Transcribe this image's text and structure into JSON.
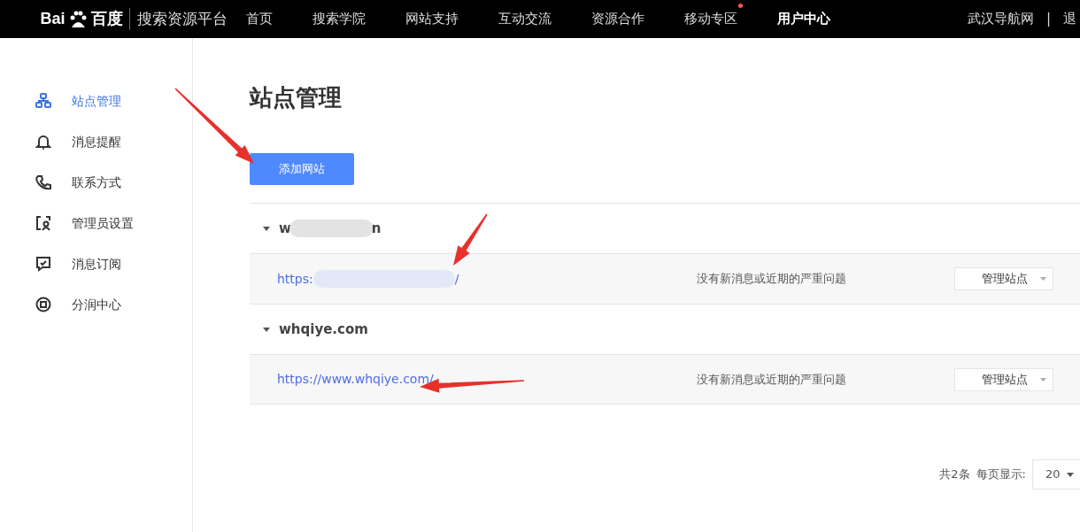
{
  "topbar": {
    "logo": {
      "left": "Bai",
      "right": "百度"
    },
    "platform": "搜索资源平台",
    "nav": [
      {
        "label": "首页",
        "selected": false,
        "badge": false
      },
      {
        "label": "搜索学院",
        "selected": false,
        "badge": false
      },
      {
        "label": "网站支持",
        "selected": false,
        "badge": false
      },
      {
        "label": "互动交流",
        "selected": false,
        "badge": false
      },
      {
        "label": "资源合作",
        "selected": false,
        "badge": false
      },
      {
        "label": "移动专区",
        "selected": false,
        "badge": true
      },
      {
        "label": "用户中心",
        "selected": true,
        "badge": false
      }
    ],
    "user": "武汉导航网",
    "separator": "|",
    "logout": "退"
  },
  "sidebar": {
    "items": [
      {
        "label": "站点管理",
        "selected": true
      },
      {
        "label": "消息提醒",
        "selected": false
      },
      {
        "label": "联系方式",
        "selected": false
      },
      {
        "label": "管理员设置",
        "selected": false
      },
      {
        "label": "消息订阅",
        "selected": false
      },
      {
        "label": "分润中心",
        "selected": false
      }
    ]
  },
  "page_title": "站点管理",
  "add_button": "添加网站",
  "site_groups": [
    {
      "domain_parts": [
        "w",
        "n"
      ],
      "expanded": true,
      "sites": [
        {
          "url_parts": [
            "https:",
            "/"
          ],
          "status": "没有新消息或近期的严重问题",
          "action": "管理站点"
        }
      ]
    },
    {
      "domain_parts": [
        "whqiye.com"
      ],
      "expanded": true,
      "sites": [
        {
          "url_parts": [
            "https://www.whqiye.com/"
          ],
          "status": "没有新消息或近期的严重问题",
          "action": "管理站点"
        }
      ]
    }
  ],
  "pagination": {
    "total": "共2条",
    "per_page_label": "每页显示:",
    "per_page": "20"
  }
}
